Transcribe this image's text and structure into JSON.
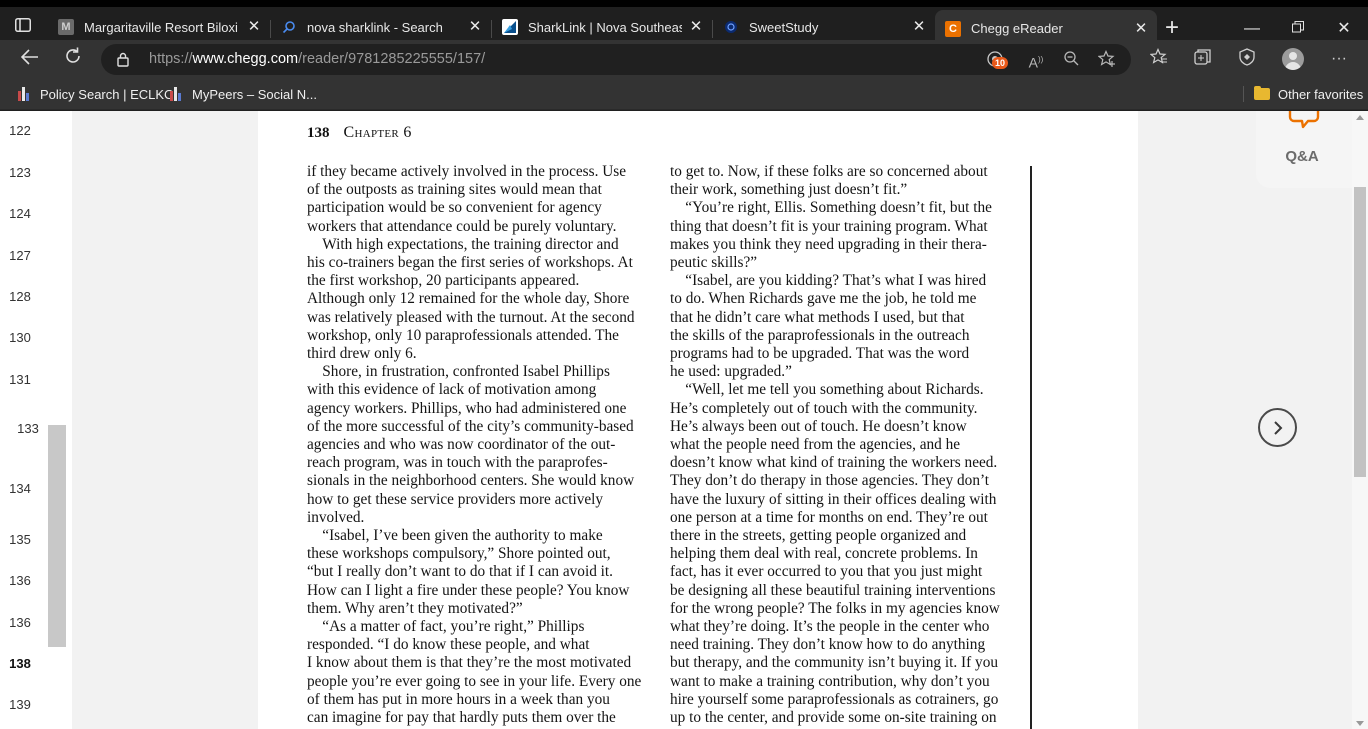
{
  "tabs": [
    {
      "title": "Margaritaville Resort Biloxi - F",
      "icon": "margaritaville-favicon",
      "favicon_letter": "M"
    },
    {
      "title": "nova sharklink - Search",
      "icon": "search-icon"
    },
    {
      "title": "SharkLink | Nova Southeastern",
      "icon": "sharklink-favicon"
    },
    {
      "title": "SweetStudy",
      "icon": "sweetstudy-favicon"
    },
    {
      "title": "Chegg eReader",
      "icon": "chegg-favicon",
      "favicon_letter": "C",
      "active": true
    }
  ],
  "address": {
    "scheme": "https://",
    "host": "www.chegg.com",
    "path": "/reader/9781285225555/157/"
  },
  "toolbar": {
    "tracker_badge": "10"
  },
  "favorites": [
    {
      "label": "Policy Search | ECLKC",
      "icon": "eclkc-favicon"
    },
    {
      "label": "MyPeers – Social N...",
      "icon": "mypeers-favicon"
    }
  ],
  "other_favorites": "Other favorites",
  "page_list": [
    "122",
    "123",
    "124",
    "127",
    "128",
    "130",
    "131",
    "133",
    "134",
    "135",
    "136",
    "136",
    "138",
    "139"
  ],
  "current_page": "138",
  "book": {
    "page_number": "138",
    "chapter": "Chapter 6",
    "left_lines": [
      "if they became actively involved in the process. Use",
      "of the outposts as training sites would mean that",
      "participation would be so convenient for agency",
      "workers that attendance could be purely voluntary.",
      " With high expectations, the training director and",
      "his co-trainers began the first series of workshops. At",
      "the first workshop, 20 participants appeared.",
      "Although only 12 remained for the whole day, Shore",
      "was relatively pleased with the turnout. At the second",
      "workshop, only 10 paraprofessionals attended. The",
      "third drew only 6.",
      " Shore, in frustration, confronted Isabel Phillips",
      "with this evidence of lack of motivation among",
      "agency workers. Phillips, who had administered one",
      "of the more successful of the city’s community-based",
      "agencies and who was now coordinator of the out-",
      "reach program, was in touch with the paraprofes-",
      "sionals in the neighborhood centers. She would know",
      "how to get these service providers more actively",
      "involved.",
      " “Isabel, I’ve been given the authority to make",
      "these workshops compulsory,” Shore pointed out,",
      "“but I really don’t want to do that if I can avoid it.",
      "How can I light a fire under these people? You know",
      "them. Why aren’t they motivated?”",
      " “As a matter of fact, you’re right,” Phillips",
      "responded. “I do know these people, and what",
      "I know about them is that they’re the most motivated",
      "people you’re ever going to see in your life. Every one",
      "of them has put in more hours in a week than you",
      "can imagine for pay that hardly puts them over the"
    ],
    "right_lines": [
      "to get to. Now, if these folks are so concerned about",
      "their work, something just doesn’t fit.”",
      " “You’re right, Ellis. Something doesn’t fit, but the",
      "thing that doesn’t fit is your training program. What",
      "makes you think they need upgrading in their thera-",
      "peutic skills?”",
      " “Isabel, are you kidding? That’s what I was hired",
      "to do. When Richards gave me the job, he told me",
      "that he didn’t care what methods I used, but that",
      "the skills of the paraprofessionals in the outreach",
      "programs had to be upgraded. That was the word",
      "he used: upgraded.”",
      " “Well, let me tell you something about Richards.",
      "He’s completely out of touch with the community.",
      "He’s always been out of touch. He doesn’t know",
      "what the people need from the agencies, and he",
      "doesn’t know what kind of training the workers need.",
      "They don’t do therapy in those agencies. They don’t",
      "have the luxury of sitting in their offices dealing with",
      "one person at a time for months on end. They’re out",
      "there in the streets, getting people organized and",
      "helping them deal with real, concrete problems. In",
      "fact, has it ever occurred to you that you just might",
      "be designing all these beautiful training interventions",
      "for the wrong people? The folks in my agencies know",
      "what they’re doing. It’s the people in the center who",
      "need training. They don’t know how to do anything",
      "but therapy, and the community isn’t buying it. If you",
      "want to make a training contribution, why don’t you",
      "hire yourself some paraprofessionals as cotrainers, go",
      "up to the center, and provide some on-site training on"
    ]
  },
  "qa_label": "Q&A",
  "colors": {
    "chegg_orange": "#eb7100",
    "browser_dark": "#333333"
  }
}
